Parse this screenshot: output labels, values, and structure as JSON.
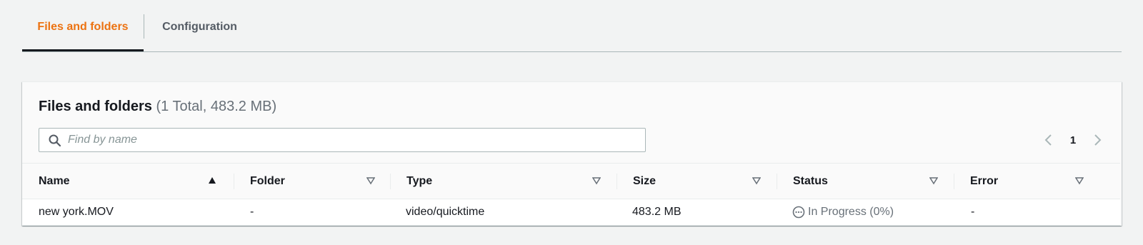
{
  "tabs": [
    {
      "label": "Files and folders",
      "active": true
    },
    {
      "label": "Configuration",
      "active": false
    }
  ],
  "panel": {
    "title": "Files and folders",
    "count": "(1 Total, 483.2 MB)"
  },
  "search": {
    "placeholder": "Find by name",
    "value": ""
  },
  "pagination": {
    "current_page": "1"
  },
  "table": {
    "columns": [
      {
        "label": "Name",
        "sort": "ascending"
      },
      {
        "label": "Folder",
        "sort": "none"
      },
      {
        "label": "Type",
        "sort": "none"
      },
      {
        "label": "Size",
        "sort": "none"
      },
      {
        "label": "Status",
        "sort": "none"
      },
      {
        "label": "Error",
        "sort": "none"
      }
    ],
    "rows": [
      {
        "name": "new york.MOV",
        "folder": "-",
        "type": "video/quicktime",
        "size": "483.2 MB",
        "status": "In Progress (0%)",
        "error": "-"
      }
    ]
  },
  "colors": {
    "accent": "#ec7211",
    "text": "#16191f",
    "muted": "#687078",
    "background": "#f2f3f3"
  },
  "icons": {
    "search": "search-icon",
    "prev": "chevron-left-icon",
    "next": "chevron-right-icon",
    "sort_asc": "sort-ascending-icon",
    "sort_none": "sort-unsorted-icon",
    "status": "in-progress-icon"
  }
}
